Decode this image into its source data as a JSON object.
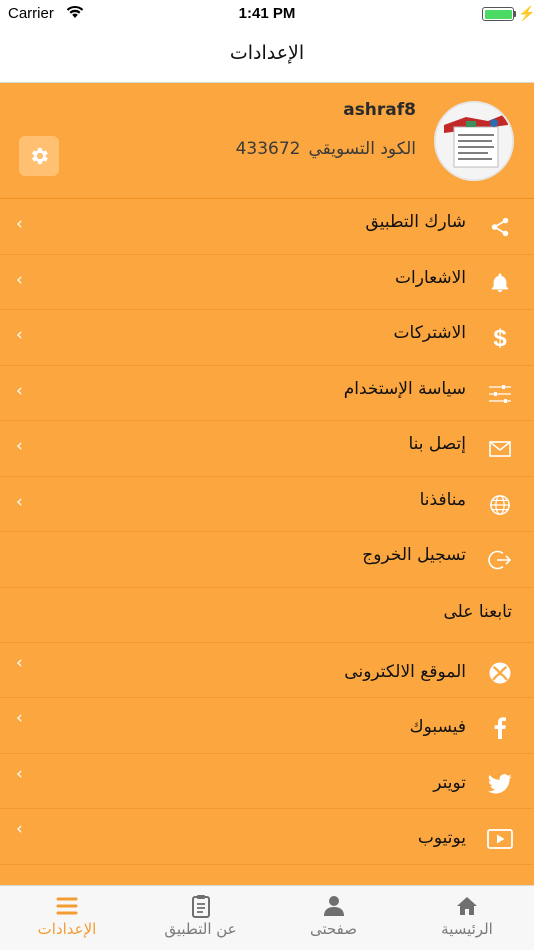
{
  "status_bar": {
    "carrier": "Carrier",
    "time": "1:41 PM"
  },
  "nav": {
    "title": "الإعدادات"
  },
  "profile": {
    "username": "ashraf8",
    "code_label": "الكود التسويقي",
    "code_value": "433672"
  },
  "menu": [
    {
      "label": "شارك التطبيق",
      "icon": "share-icon"
    },
    {
      "label": "الاشعارات",
      "icon": "bell-icon"
    },
    {
      "label": "الاشتركات",
      "icon": "dollar-icon"
    },
    {
      "label": "سياسة الإستخدام",
      "icon": "sliders-icon"
    },
    {
      "label": "إتصل بنا",
      "icon": "mail-icon"
    },
    {
      "label": "منافذنا",
      "icon": "globe-icon"
    },
    {
      "label": "تسجيل الخروج",
      "icon": "logout-icon"
    }
  ],
  "follow_section": {
    "title": "تابعنا على"
  },
  "social": [
    {
      "label": "الموقع الالكترونى",
      "icon": "xbox-icon"
    },
    {
      "label": "فيسبوك",
      "icon": "facebook-icon"
    },
    {
      "label": "تويتر",
      "icon": "twitter-icon"
    },
    {
      "label": "يوتيوب",
      "icon": "youtube-icon"
    }
  ],
  "tabs": [
    {
      "label": "الرئيسية",
      "icon": "home-icon",
      "active": false
    },
    {
      "label": "صفحتى",
      "icon": "person-icon",
      "active": false
    },
    {
      "label": "عن التطبيق",
      "icon": "clipboard-icon",
      "active": false
    },
    {
      "label": "الإعدادات",
      "icon": "menu-icon",
      "active": true
    }
  ],
  "colors": {
    "primary": "#fba63f",
    "divider": "#f29a2f",
    "active_tab": "#f39c33",
    "inactive_tab": "#7a7a7a"
  }
}
